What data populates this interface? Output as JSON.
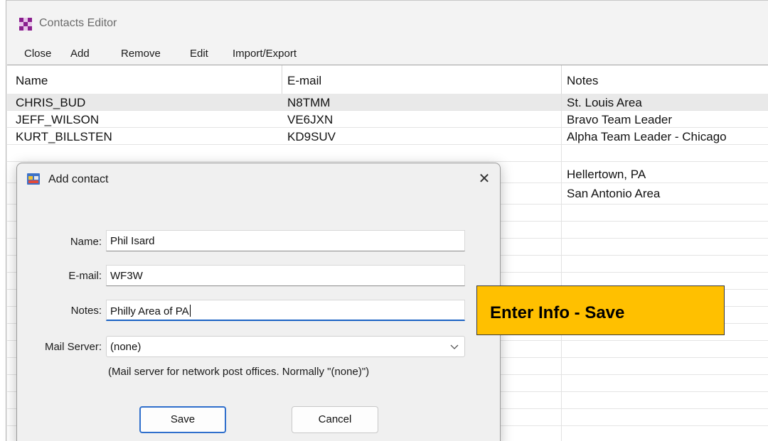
{
  "window": {
    "title": "Contacts Editor"
  },
  "menu": [
    "Close",
    "Add",
    "Remove",
    "Edit",
    "Import/Export"
  ],
  "table": {
    "columns": [
      "Name",
      "E-mail",
      "Notes"
    ],
    "rows": [
      {
        "name": "CHRIS_BUD",
        "email": "N8TMM",
        "notes": "St. Louis Area",
        "selected": true
      },
      {
        "name": "JEFF_WILSON",
        "email": "VE6JXN",
        "notes": "Bravo Team Leader"
      },
      {
        "name": "KURT_BILLSTEN",
        "email": "KD9SUV",
        "notes": "Alpha Team Leader - Chicago"
      },
      {
        "name": "",
        "email": "",
        "notes": ""
      },
      {
        "name": "",
        "email": "",
        "notes": "Hellertown, PA"
      },
      {
        "name": "",
        "email": "",
        "notes": "San Antonio Area"
      }
    ]
  },
  "dialog": {
    "title": "Add contact",
    "close_icon": "close-icon",
    "fields": {
      "name": {
        "label": "Name:",
        "value": "Phil Isard"
      },
      "email": {
        "label": "E-mail:",
        "value": "WF3W"
      },
      "notes": {
        "label": "Notes:",
        "value": "Philly Area of PA"
      },
      "mail_server": {
        "label": "Mail Server:",
        "value": "(none)"
      }
    },
    "hint": "(Mail server for network post offices.  Normally \"(none)\")",
    "buttons": {
      "save": "Save",
      "cancel": "Cancel"
    }
  },
  "callout": {
    "text": "Enter Info - Save",
    "color": "#ffc000"
  },
  "colors": {
    "accent": "#2f6fcc",
    "selected_row": "#e9e9e9"
  }
}
